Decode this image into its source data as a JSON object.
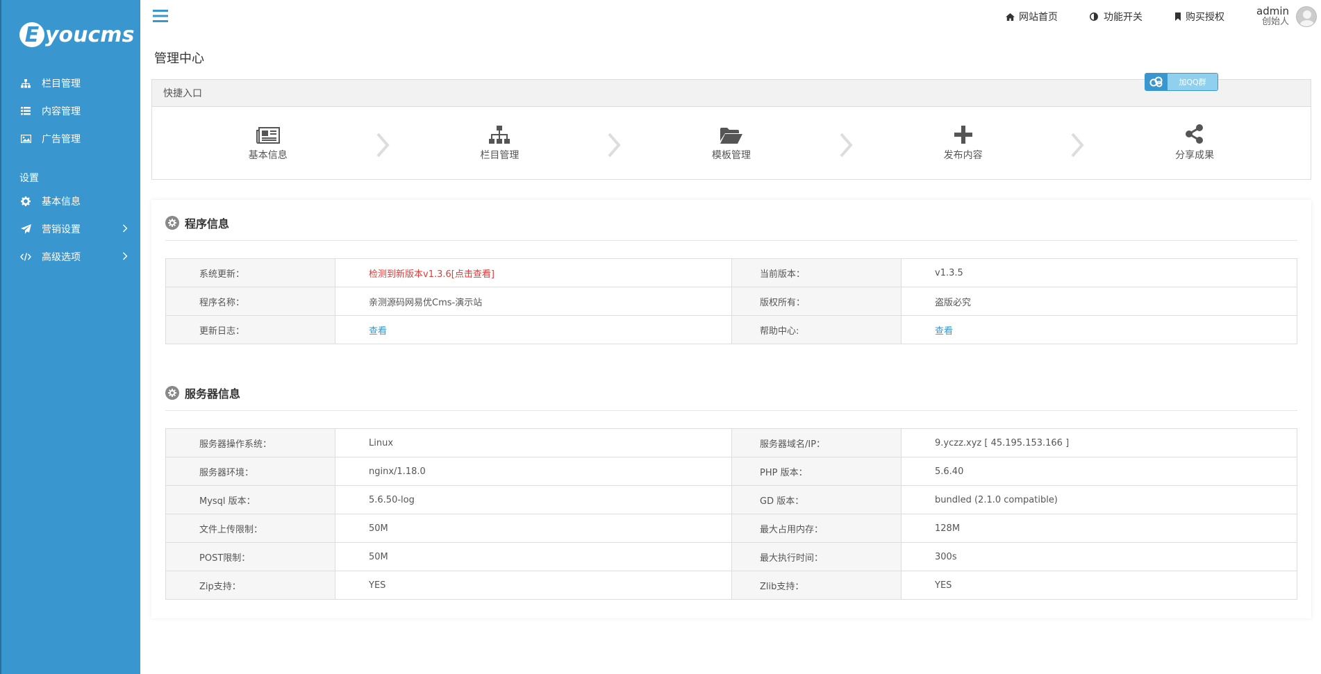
{
  "logo": {
    "mark": "E",
    "text": "youcms"
  },
  "sidebar": {
    "items": [
      {
        "label": "栏目管理",
        "icon": "sitemap-icon"
      },
      {
        "label": "内容管理",
        "icon": "list-icon"
      },
      {
        "label": "广告管理",
        "icon": "image-icon"
      }
    ],
    "section_label": "设置",
    "settings": [
      {
        "label": "基本信息",
        "icon": "gear-icon"
      },
      {
        "label": "营销设置",
        "icon": "paper-plane-icon"
      },
      {
        "label": "高级选项",
        "icon": "code-icon"
      }
    ]
  },
  "topbar": {
    "links": [
      {
        "label": "网站首页",
        "icon": "home-icon"
      },
      {
        "label": "功能开关",
        "icon": "toggle-icon"
      },
      {
        "label": "购买授权",
        "icon": "bookmark-icon"
      }
    ],
    "user": {
      "name": "admin",
      "role": "创始人"
    }
  },
  "main": {
    "title": "管理中心",
    "quick": {
      "title": "快捷入口",
      "items": [
        {
          "label": "基本信息",
          "icon": "newspaper-icon"
        },
        {
          "label": "栏目管理",
          "icon": "sitemap-icon"
        },
        {
          "label": "模板管理",
          "icon": "folder-open-icon"
        },
        {
          "label": "发布内容",
          "icon": "plus-icon"
        },
        {
          "label": "分享成果",
          "icon": "share-icon"
        }
      ]
    },
    "badge_label": "加QQ群",
    "program": {
      "title": "程序信息",
      "rows": [
        {
          "k1": "系统更新：",
          "v1": "检测到新版本v1.3.6[点击查看]",
          "k2": "当前版本：",
          "v2": "v1.3.5"
        },
        {
          "k1": "程序名称：",
          "v1": "亲测源码网易优Cms-演示站",
          "k2": "版权所有：",
          "v2": "盗版必究"
        },
        {
          "k1": "更新日志：",
          "v1": "查看",
          "k2": "帮助中心:",
          "v2": "查看"
        }
      ]
    },
    "server": {
      "title": "服务器信息",
      "rows": [
        {
          "k1": "服务器操作系统：",
          "v1": "Linux",
          "k2": "服务器域名/IP：",
          "v2": "9.yczz.xyz [ 45.195.153.166 ]"
        },
        {
          "k1": "服务器环境：",
          "v1": "nginx/1.18.0",
          "k2": "PHP 版本：",
          "v2": "5.6.40"
        },
        {
          "k1": "Mysql 版本：",
          "v1": "5.6.50-log",
          "k2": "GD 版本：",
          "v2": "bundled (2.1.0 compatible)"
        },
        {
          "k1": "文件上传限制：",
          "v1": "50M",
          "k2": "最大占用内存：",
          "v2": "128M"
        },
        {
          "k1": "POST限制：",
          "v1": "50M",
          "k2": "最大执行时间：",
          "v2": "300s"
        },
        {
          "k1": "Zip支持：",
          "v1": "YES",
          "k2": "Zlib支持：",
          "v2": "YES"
        }
      ]
    }
  }
}
